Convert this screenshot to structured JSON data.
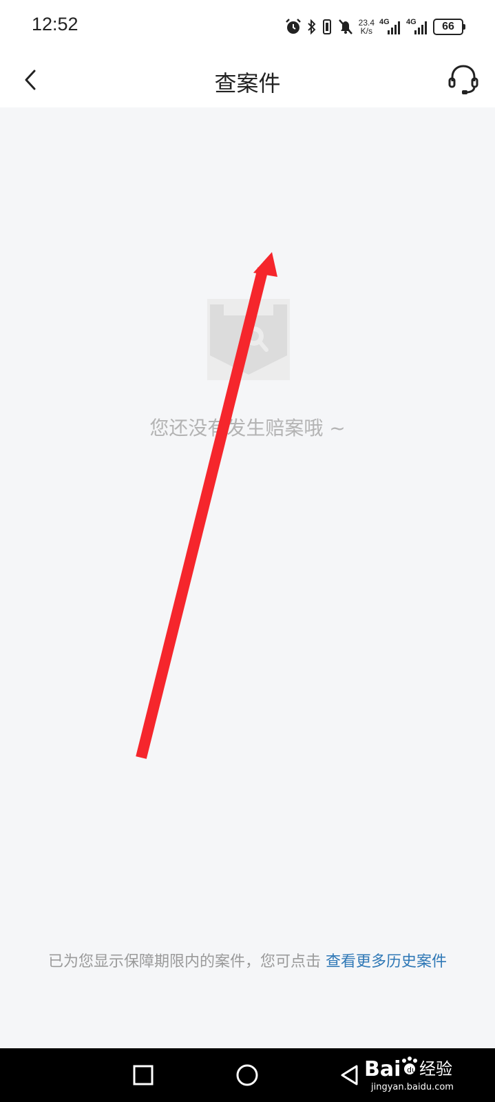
{
  "status_bar": {
    "time": "12:52",
    "net_speed_value": "23.4",
    "net_speed_unit": "K/s",
    "signal1_label": "4G",
    "signal2_label": "4G",
    "battery_level": "66",
    "icons": [
      "alarm-icon",
      "bluetooth-icon",
      "vibrate-icon",
      "mute-icon",
      "signal-icon",
      "signal-icon",
      "battery-icon"
    ]
  },
  "header": {
    "title": "查案件",
    "back_icon": "back-arrow-icon",
    "service_icon": "customer-service-icon"
  },
  "empty_state": {
    "icon": "shield-search-icon",
    "message": "您还没有发生赔案哦 ~"
  },
  "footer": {
    "note": "已为您显示保障期限内的案件，您可点击 ",
    "link": "查看更多历史案件"
  },
  "nav_bar": {
    "icons": [
      "recents-square-icon",
      "home-circle-icon",
      "back-triangle-icon"
    ]
  },
  "watermark": {
    "brand": "Bai",
    "brand_suffix": "经验",
    "url": "jingyan.baidu.com"
  },
  "colors": {
    "background": "#f5f6f8",
    "link": "#2f78b6",
    "annotation_arrow": "#f5262c"
  }
}
